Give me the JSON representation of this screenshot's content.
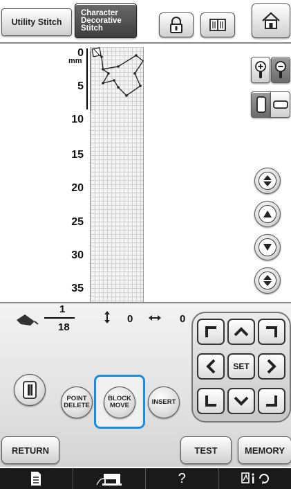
{
  "tabs": {
    "utility": "Utility Stitch",
    "character_line1": "Character",
    "character_line2": "Decorative",
    "character_line3": "Stitch"
  },
  "toolbar_icons": [
    "lock-icon",
    "manual-icon",
    "home-icon"
  ],
  "ruler": {
    "unit": "mm",
    "labels": [
      "0",
      "5",
      "10",
      "15",
      "20",
      "25",
      "30",
      "35"
    ]
  },
  "status": {
    "point_current": "1",
    "point_total": "18",
    "vertical_value": "0",
    "horizontal_value": "0"
  },
  "dpad": {
    "set_label": "SET"
  },
  "modes": {
    "point_delete": "POINT\nDELETE",
    "block_move": "BLOCK\nMOVE",
    "insert": "INSERT"
  },
  "actions": {
    "return": "RETURN",
    "test": "TEST",
    "memory": "MEMORY"
  },
  "footer": {
    "help": "?"
  },
  "colors": {
    "selection": "#1b8be0",
    "footer_bg": "#1a1a1a"
  }
}
